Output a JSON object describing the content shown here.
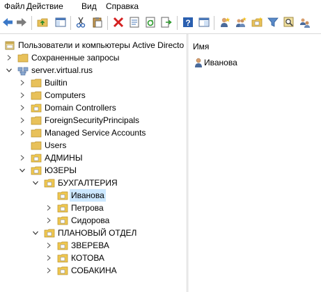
{
  "menu": [
    "Файл",
    "Действие",
    "Вид",
    "Справка"
  ],
  "toolbar_icons": [
    "back-arrow-icon",
    "forward-arrow-icon",
    "up-folder-icon",
    "show-hide-console-tree-icon",
    "cut-icon",
    "paste-icon",
    "delete-icon",
    "properties-icon",
    "refresh-icon",
    "export-list-icon",
    "help-icon",
    "console-view-icon",
    "new-user-icon",
    "new-group-icon",
    "new-ou-icon",
    "filter-icon",
    "find-icon",
    "add-to-group-icon"
  ],
  "tree": {
    "root": "Пользователи и компьютеры Active Directo",
    "saved_queries": "Сохраненные запросы",
    "domain": "server.virtual.rus",
    "children": [
      {
        "label": "Builtin",
        "type": "folder",
        "arrow": "right"
      },
      {
        "label": "Computers",
        "type": "folder",
        "arrow": "right"
      },
      {
        "label": "Domain Controllers",
        "type": "ou",
        "arrow": "right"
      },
      {
        "label": "ForeignSecurityPrincipals",
        "type": "folder",
        "arrow": "right"
      },
      {
        "label": "Managed Service Accounts",
        "type": "folder",
        "arrow": "right"
      },
      {
        "label": "Users",
        "type": "folder",
        "arrow": "none"
      },
      {
        "label": "АДМИНЫ",
        "type": "ou",
        "arrow": "right"
      },
      {
        "label": "ЮЗЕРЫ",
        "type": "ou",
        "arrow": "down"
      }
    ],
    "yuzery": [
      {
        "label": "БУХГАЛТЕРИЯ",
        "arrow": "down"
      },
      {
        "label": "ПЛАНОВЫЙ ОТДЕЛ",
        "arrow": "down"
      }
    ],
    "buh": [
      {
        "label": "Иванова",
        "arrow": "none",
        "selected": true
      },
      {
        "label": "Петрова",
        "arrow": "right",
        "selected": false
      },
      {
        "label": "Сидорова",
        "arrow": "right",
        "selected": false
      }
    ],
    "plan": [
      {
        "label": "ЗВЕРЕВА",
        "arrow": "right"
      },
      {
        "label": "КОТОВА",
        "arrow": "right"
      },
      {
        "label": "СОБАКИНА",
        "arrow": "right"
      }
    ]
  },
  "details": {
    "column_header": "Имя",
    "items": [
      {
        "name": "Иванова",
        "icon": "user-icon"
      }
    ]
  },
  "colors": {
    "selection": "#cce8ff",
    "folder": "#e8c15a",
    "ou_folder": "#f0c850"
  }
}
